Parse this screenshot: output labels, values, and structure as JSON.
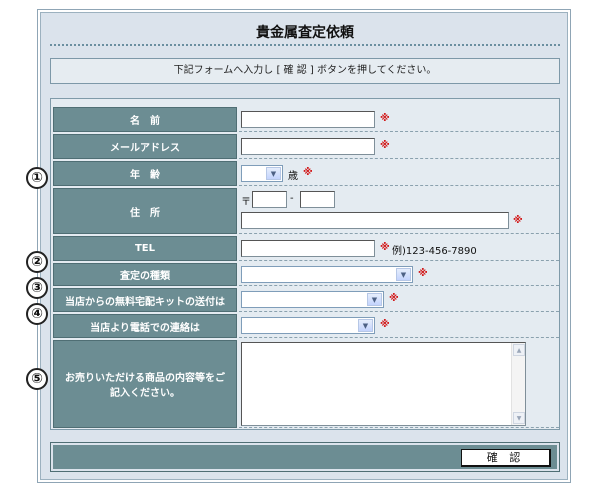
{
  "title": "貴金属査定依頼",
  "instruction": "下記フォームへ入力し [ 確 認 ] ボタンを押してください。",
  "required_mark": "※",
  "markers": [
    "①",
    "②",
    "③",
    "④",
    "⑤"
  ],
  "fields": {
    "name": {
      "label": "名　前",
      "value": ""
    },
    "email": {
      "label": "メールアドレス",
      "value": ""
    },
    "age": {
      "label": "年　齢",
      "selected": "",
      "suffix": "歳"
    },
    "address": {
      "label": "住　所",
      "postal_prefix": "〒",
      "postal_sep": "-",
      "zip1": "",
      "zip2": "",
      "street": ""
    },
    "tel": {
      "label": "TEL",
      "value": "",
      "example": "例)123-456-7890"
    },
    "appraisal_type": {
      "label": "査定の種類",
      "selected": ""
    },
    "kit": {
      "label": "当店からの無料宅配キットの送付は",
      "selected": ""
    },
    "phone_contact": {
      "label": "当店より電話での連絡は",
      "selected": ""
    },
    "details": {
      "label": "お売りいただける商品の内容等をご記入ください。",
      "value": ""
    }
  },
  "confirm_button": "確 認"
}
